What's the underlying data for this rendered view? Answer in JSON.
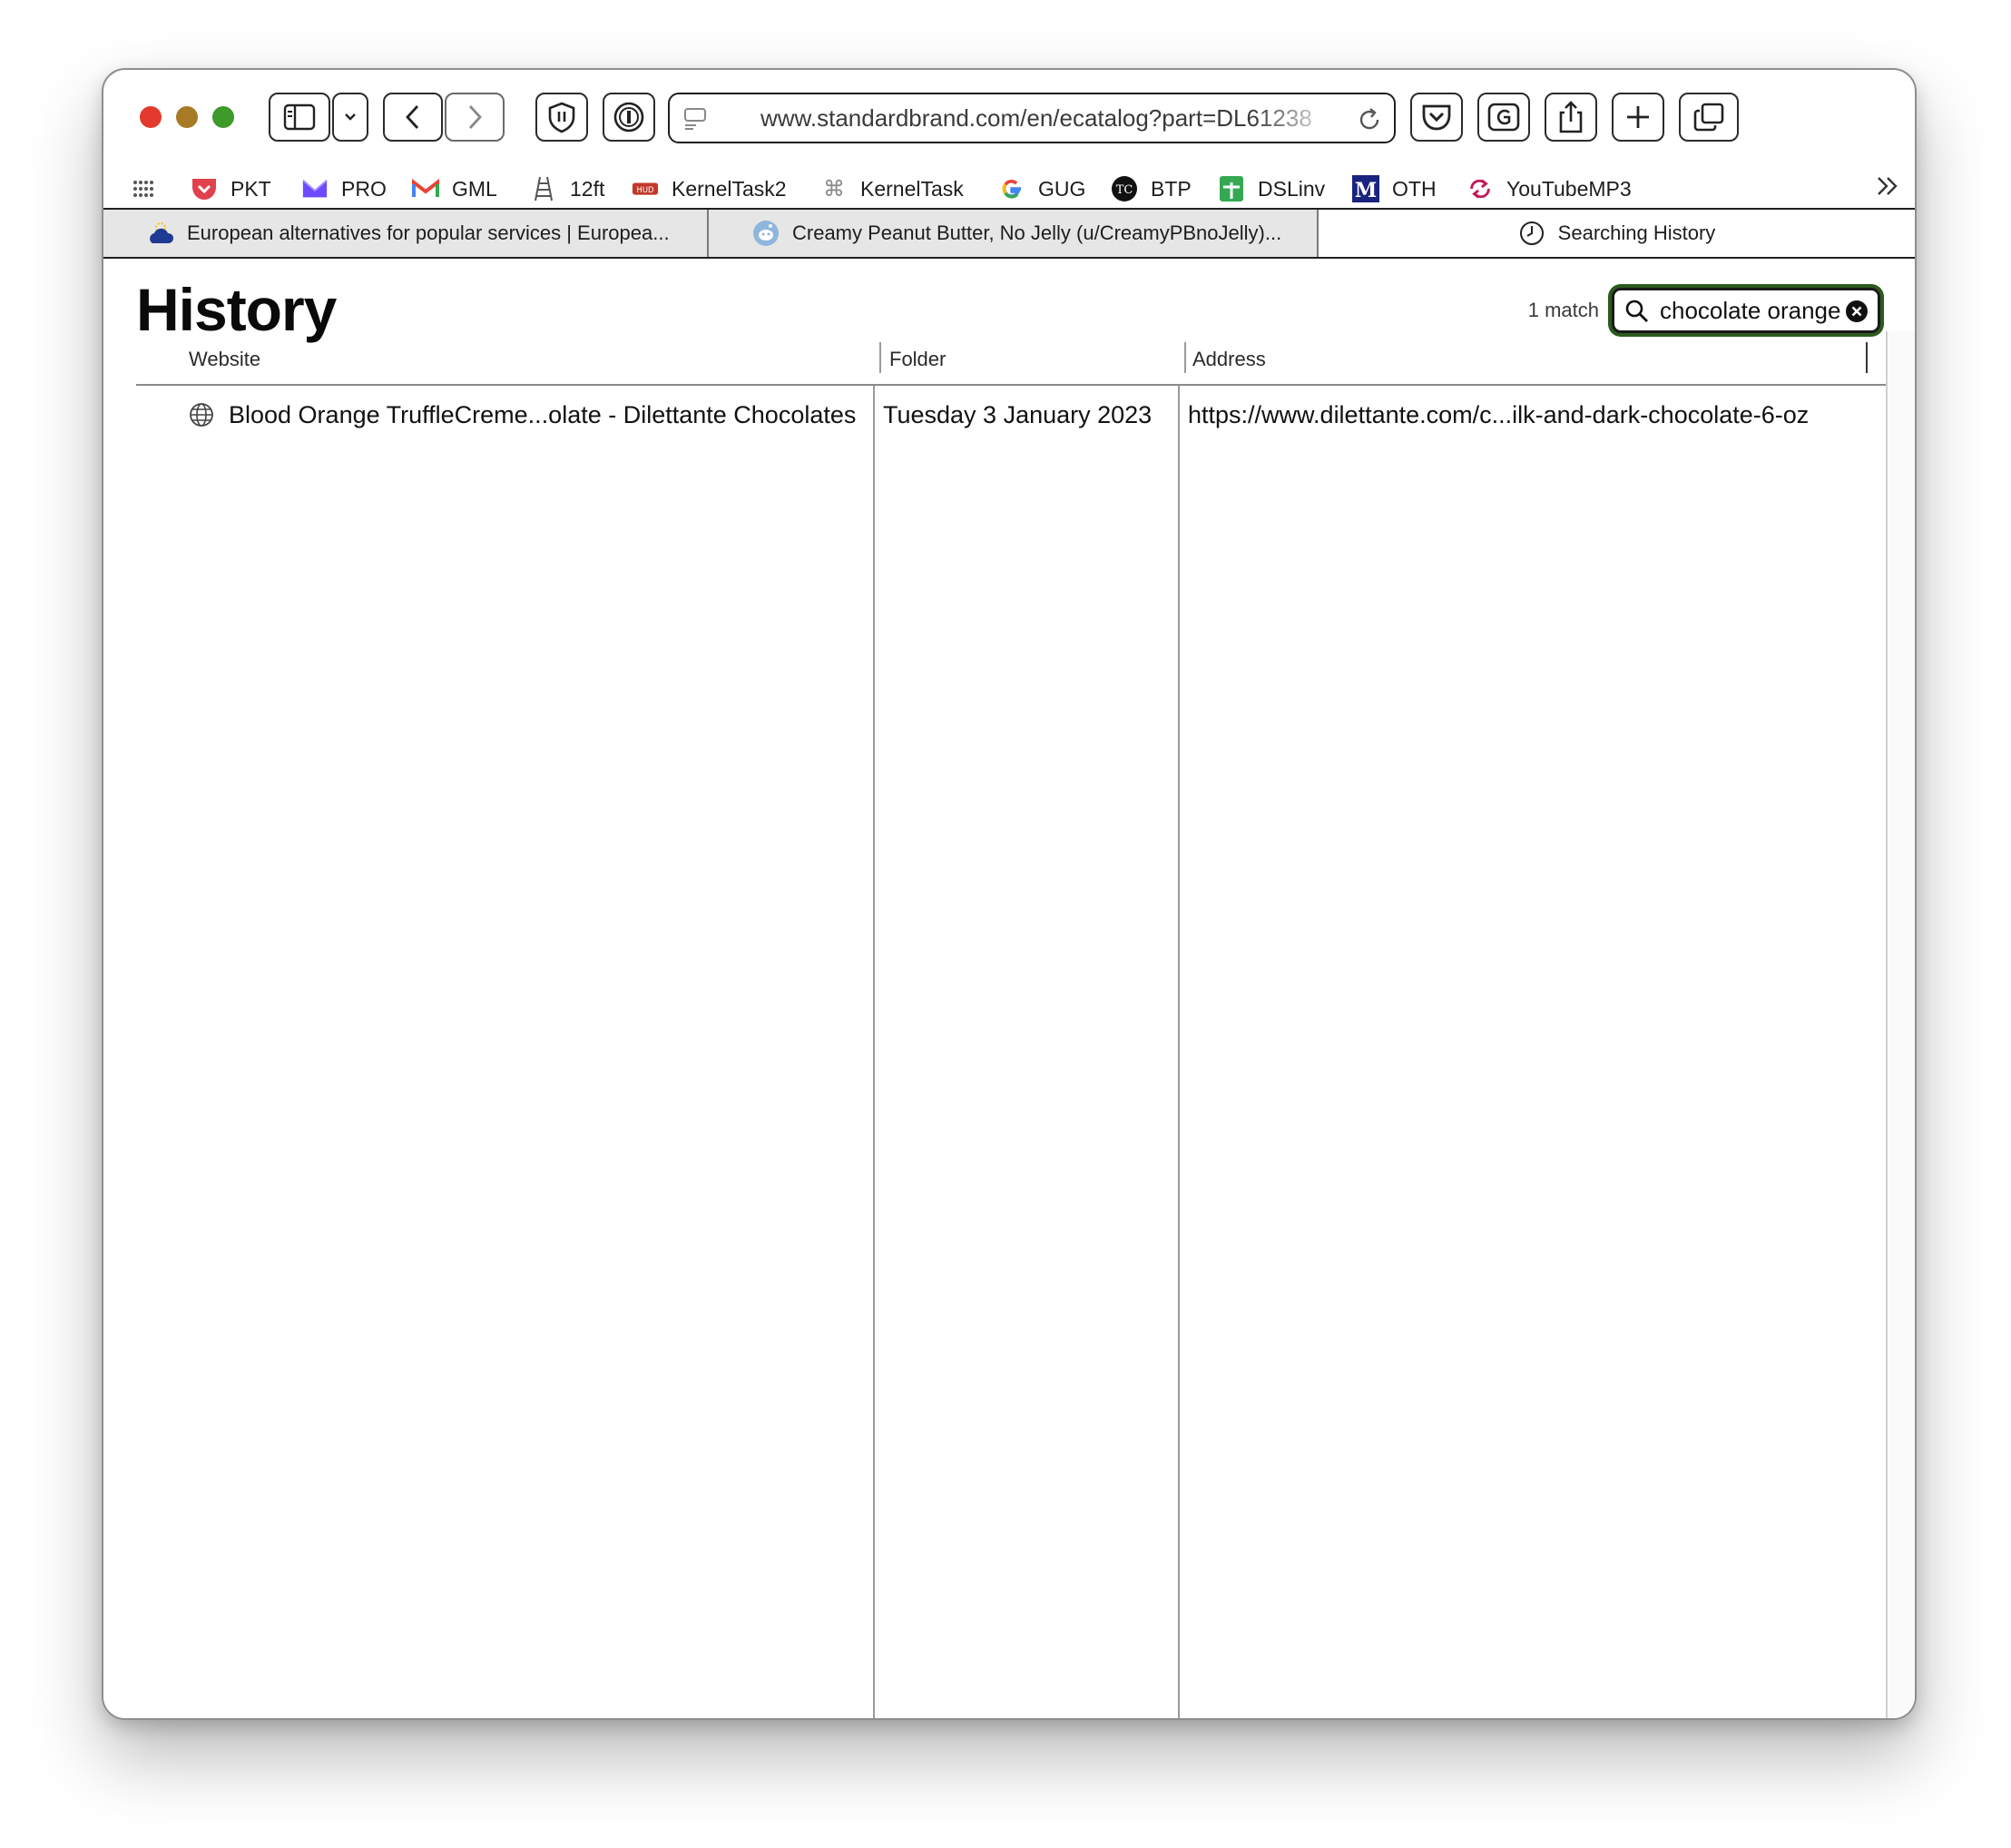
{
  "browser": {
    "url": "www.standardbrand.com/en/ecatalog?part=DL61238"
  },
  "bookmarks": [
    {
      "label": "PKT",
      "icon": "pocket-icon",
      "color": "#e0414d"
    },
    {
      "label": "PRO",
      "icon": "proton-mail-icon",
      "color": "#6d4aff"
    },
    {
      "label": "GML",
      "icon": "gmail-icon",
      "color": "#ea4335"
    },
    {
      "label": "12ft",
      "icon": "ladder-icon",
      "color": "#555555"
    },
    {
      "label": "KernelTask2",
      "icon": "kerneltask2-icon",
      "color": "#c0392b"
    },
    {
      "label": "KernelTask",
      "icon": "command-icon",
      "color": "#888888"
    },
    {
      "label": "GUG",
      "icon": "google-icon",
      "color": "#4285f4"
    },
    {
      "label": "BTP",
      "icon": "techcrunch-icon",
      "color": "#111111"
    },
    {
      "label": "DSLinv",
      "icon": "sheets-icon",
      "color": "#34a853"
    },
    {
      "label": "OTH",
      "icon": "m-icon",
      "color": "#1a237e"
    },
    {
      "label": "YouTubeMP3",
      "icon": "convert-icon",
      "color": "#c2185b"
    }
  ],
  "tabs": [
    {
      "title": "European alternatives for popular services | Europea...",
      "icon": "cloud-icon"
    },
    {
      "title": "Creamy Peanut Butter, No Jelly (u/CreamyPBnoJelly)...",
      "icon": "reddit-icon"
    },
    {
      "title": "Searching History",
      "icon": "clock-icon",
      "active": true
    }
  ],
  "history": {
    "title": "History",
    "match_count": "1 match",
    "search_value": "chocolate orange",
    "columns": [
      "Website",
      "Folder",
      "Address"
    ],
    "rows": [
      {
        "website": "Blood Orange TruffleCreme...olate - Dilettante Chocolates",
        "folder": "Tuesday 3 January 2023",
        "address": "https://www.dilettante.com/c...ilk-and-dark-chocolate-6-oz"
      }
    ]
  },
  "colors": {
    "search_focus_ring": "#2c5a1e",
    "close_red": "#e33a2d",
    "minimize_yellow": "#a87a26",
    "zoom_green": "#3e9a2a"
  }
}
